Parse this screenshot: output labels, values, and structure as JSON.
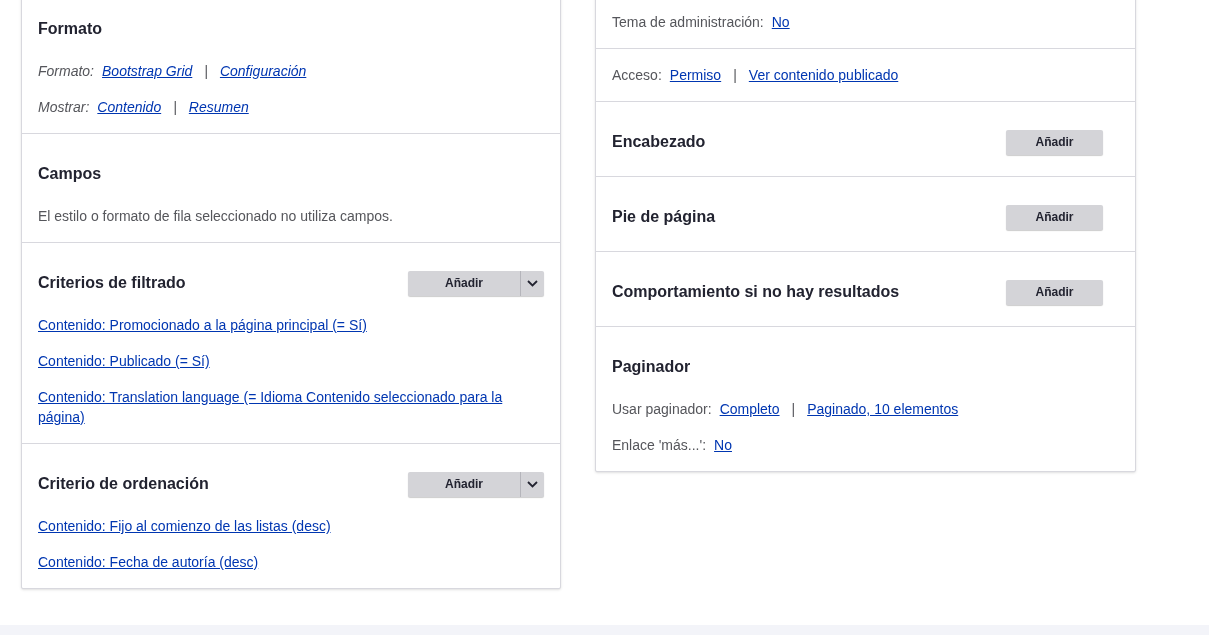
{
  "left_panel": {
    "sections": [
      {
        "title": "Formato",
        "rows": [
          {
            "kind": "meta",
            "italic": true,
            "label": "Formato:",
            "links": [
              "Bootstrap Grid",
              "Configuración"
            ],
            "separator": "|"
          },
          {
            "kind": "meta",
            "italic": true,
            "label": "Mostrar:",
            "links": [
              "Contenido",
              "Resumen"
            ],
            "separator": "|"
          }
        ]
      },
      {
        "title": "Campos",
        "rows": [
          {
            "kind": "text",
            "text": "El estilo o formato de fila seleccionado no utiliza campos."
          }
        ]
      },
      {
        "title": "Criterios de filtrado",
        "add_button": {
          "label": "Añadir",
          "dropdown": true
        },
        "rows": [
          {
            "kind": "link",
            "text": "Contenido: Promocionado a la página principal (= Sí)"
          },
          {
            "kind": "link",
            "text": "Contenido: Publicado (= Sí)"
          },
          {
            "kind": "link",
            "text": "Contenido: Translation language (= Idioma Contenido seleccionado para la página)"
          }
        ]
      },
      {
        "title": "Criterio de ordenación",
        "add_button": {
          "label": "Añadir",
          "dropdown": true
        },
        "rows": [
          {
            "kind": "link",
            "text": "Contenido: Fijo al comienzo de las listas (desc)"
          },
          {
            "kind": "link",
            "text": "Contenido: Fecha de autoría (desc)"
          }
        ]
      }
    ]
  },
  "right_panel": {
    "sections": [
      {
        "rows": [
          {
            "kind": "meta",
            "italic": false,
            "label": "Tema de administración:",
            "links": [
              "No"
            ]
          }
        ]
      },
      {
        "rows": [
          {
            "kind": "meta",
            "italic": false,
            "label": "Acceso:",
            "links": [
              "Permiso",
              "Ver contenido publicado"
            ],
            "separator": "|"
          }
        ]
      },
      {
        "title": "Encabezado",
        "add_button": {
          "label": "Añadir",
          "dropdown": false
        }
      },
      {
        "title": "Pie de página",
        "add_button": {
          "label": "Añadir",
          "dropdown": false
        }
      },
      {
        "title": "Comportamiento si no hay resultados",
        "add_button": {
          "label": "Añadir",
          "dropdown": false
        }
      },
      {
        "title": "Paginador",
        "rows": [
          {
            "kind": "meta",
            "italic": false,
            "label": "Usar paginador:",
            "links": [
              "Completo",
              "Paginado, 10 elementos"
            ],
            "separator": "|"
          },
          {
            "kind": "meta",
            "italic": false,
            "label": "Enlace 'más...':",
            "links": [
              "No"
            ]
          }
        ]
      }
    ]
  }
}
